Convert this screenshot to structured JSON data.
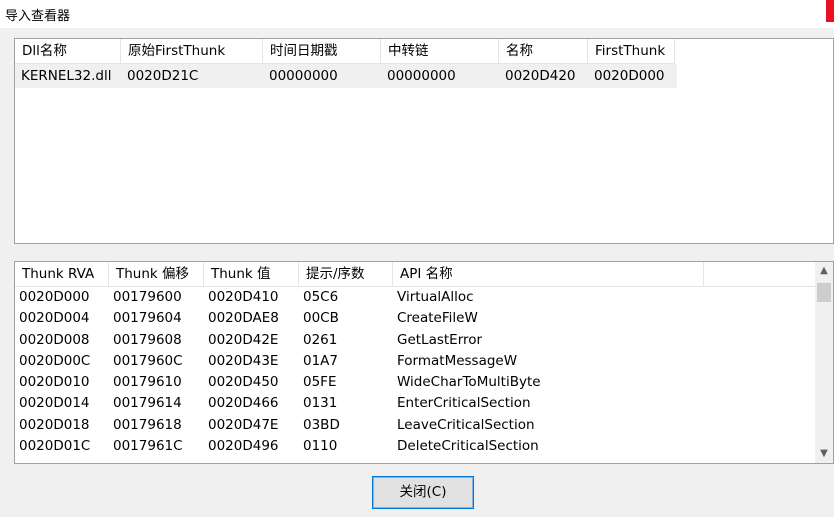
{
  "window": {
    "title": "导入查看器"
  },
  "dll_list": {
    "columns": [
      "Dll名称",
      "原始FirstThunk",
      "时间日期戳",
      "中转链",
      "名称",
      "FirstThunk"
    ],
    "rows": [
      [
        "KERNEL32.dll",
        "0020D21C",
        "00000000",
        "00000000",
        "0020D420",
        "0020D000"
      ]
    ]
  },
  "thunk_list": {
    "columns": [
      "Thunk RVA",
      "Thunk 偏移",
      "Thunk 值",
      "提示/序数",
      "API 名称"
    ],
    "rows": [
      [
        "0020D000",
        "00179600",
        "0020D410",
        "05C6",
        "VirtualAlloc"
      ],
      [
        "0020D004",
        "00179604",
        "0020DAE8",
        "00CB",
        "CreateFileW"
      ],
      [
        "0020D008",
        "00179608",
        "0020D42E",
        "0261",
        "GetLastError"
      ],
      [
        "0020D00C",
        "0017960C",
        "0020D43E",
        "01A7",
        "FormatMessageW"
      ],
      [
        "0020D010",
        "00179610",
        "0020D450",
        "05FE",
        "WideCharToMultiByte"
      ],
      [
        "0020D014",
        "00179614",
        "0020D466",
        "0131",
        "EnterCriticalSection"
      ],
      [
        "0020D018",
        "00179618",
        "0020D47E",
        "03BD",
        "LeaveCriticalSection"
      ],
      [
        "0020D01C",
        "0017961C",
        "0020D496",
        "0110",
        "DeleteCriticalSection"
      ]
    ]
  },
  "close_button": {
    "label": "关闭(C)"
  },
  "icons": {
    "scroll_up": "scroll-up-arrow-icon",
    "scroll_down": "scroll-down-arrow-icon"
  }
}
